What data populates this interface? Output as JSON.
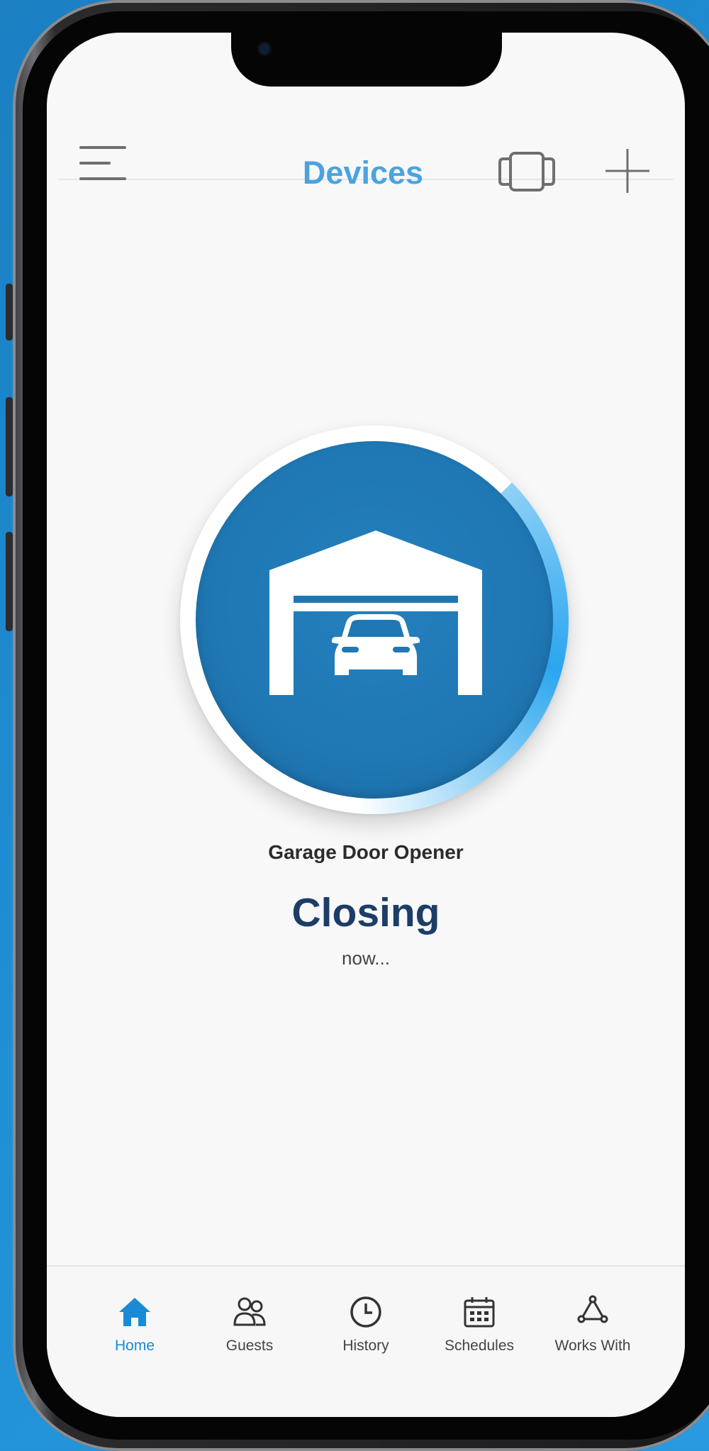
{
  "header": {
    "title": "Devices",
    "menu_icon": "hamburger-menu-icon",
    "switch_icon": "device-switch-icon",
    "add_icon": "add-plus-icon"
  },
  "device": {
    "name": "Garage Door Opener",
    "status": "Closing",
    "substatus": "now...",
    "icon": "garage-car-icon"
  },
  "tabs": [
    {
      "label": "Home",
      "icon": "home-icon",
      "active": true
    },
    {
      "label": "Guests",
      "icon": "guests-icon",
      "active": false
    },
    {
      "label": "History",
      "icon": "clock-icon",
      "active": false
    },
    {
      "label": "Schedules",
      "icon": "calendar-icon",
      "active": false
    },
    {
      "label": "Works With",
      "icon": "works-with-icon",
      "active": false
    }
  ],
  "colors": {
    "background": "#1f8fd6",
    "accent": "#1a8ad6",
    "title": "#4aa3df",
    "status": "#1c3d66",
    "circle": "#1f77b3"
  }
}
